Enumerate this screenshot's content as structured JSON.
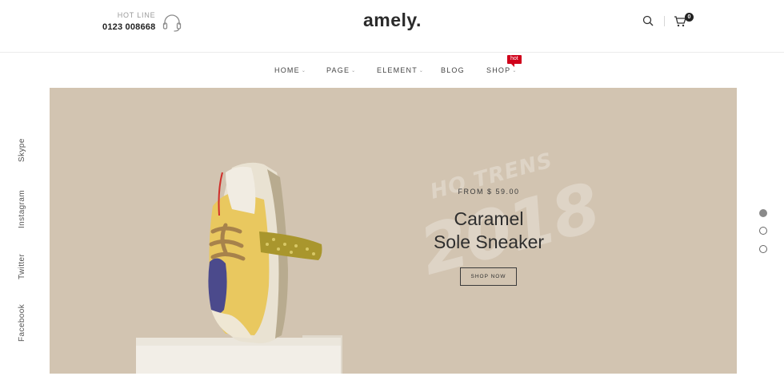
{
  "header": {
    "hotline_label": "HOT LINE",
    "hotline_number": "0123 008668",
    "logo": "amely.",
    "cart_count": "0",
    "icons": [
      "headset-icon",
      "search-icon",
      "cart-icon"
    ]
  },
  "nav": {
    "items": [
      {
        "label": "HOME"
      },
      {
        "label": "PAGE"
      },
      {
        "label": "ELEMENT"
      },
      {
        "label": "BLOG"
      },
      {
        "label": "SHOP"
      }
    ],
    "hot_badge": "hot"
  },
  "social": [
    "Skype",
    "Instagram",
    "Twitter",
    "Facebook"
  ],
  "hero": {
    "background_text_top": "HO TRENS",
    "background_text_year": "2018",
    "from_price": "FROM $ 59.00",
    "title_line1": "Caramel",
    "title_line2": "Sole Sneaker",
    "button_label": "SHOP NOW",
    "background_color": "#d2c4b1"
  },
  "slider": {
    "active_index": 0,
    "count": 3
  }
}
